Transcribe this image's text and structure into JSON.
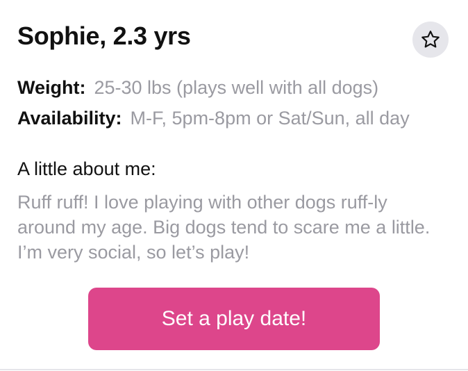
{
  "profile": {
    "title": "Sophie, 2.3 yrs",
    "favorite_icon": "star-outline-icon",
    "weight_label": "Weight:",
    "weight_value": "25-30 lbs (plays well with all dogs)",
    "availability_label": "Availability:",
    "availability_value": "M-F, 5pm-8pm or Sat/Sun, all day",
    "about_heading": "A little about me:",
    "about_text": "Ruff ruff! I love playing with other dogs ruff-ly around my age. Big dogs tend to scare me a little. I’m very social, so let’s play!",
    "cta_label": "Set a play date!"
  },
  "colors": {
    "accent": "#dd468b",
    "muted_text": "#9a9aa1",
    "star_bg": "#e6e6eb"
  }
}
